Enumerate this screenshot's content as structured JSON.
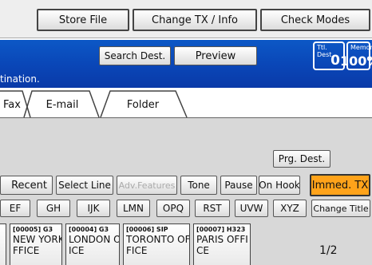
{
  "top_bar": {
    "store_file": "Store File",
    "change_tx": "Change TX / Info",
    "check_modes": "Check Modes"
  },
  "header": {
    "search_dest": "Search Dest.",
    "preview": "Preview",
    "prompt": "tination.",
    "total_dest_label": "Ttl. Dest.",
    "total_dest_value": "0",
    "memory_label": "Memory",
    "memory_value": "100%"
  },
  "tabs": [
    "Fax",
    "E-mail",
    "Folder"
  ],
  "actions": {
    "prg_dest": "Prg. Dest.",
    "recent": "Recent",
    "select_line": "Select Line",
    "adv_features": "Adv.Features",
    "tone": "Tone",
    "pause": "Pause",
    "on_hook": "On Hook",
    "immed_tx": "Immed. TX"
  },
  "index_tabs": [
    "EF",
    "GH",
    "IJK",
    "LMN",
    "OPQ",
    "RST",
    "UVW",
    "XYZ"
  ],
  "change_title": "Change Title",
  "destinations": [
    {
      "num": "[00005] G3",
      "name": "NEW YORK O",
      "name2": "FFICE"
    },
    {
      "num": "[00004] G3",
      "name": "LONDON OFF",
      "name2": "ICE"
    },
    {
      "num": "[00006] SIP",
      "name": "TORONTO OF",
      "name2": "FICE"
    },
    {
      "num": "[00007] H323",
      "name": "PARIS OFFI",
      "name2": "CE"
    }
  ],
  "page_indicator": "1/2",
  "colors": {
    "header_blue": "#0a47b8",
    "immed_tx_orange": "#ffa31a"
  }
}
